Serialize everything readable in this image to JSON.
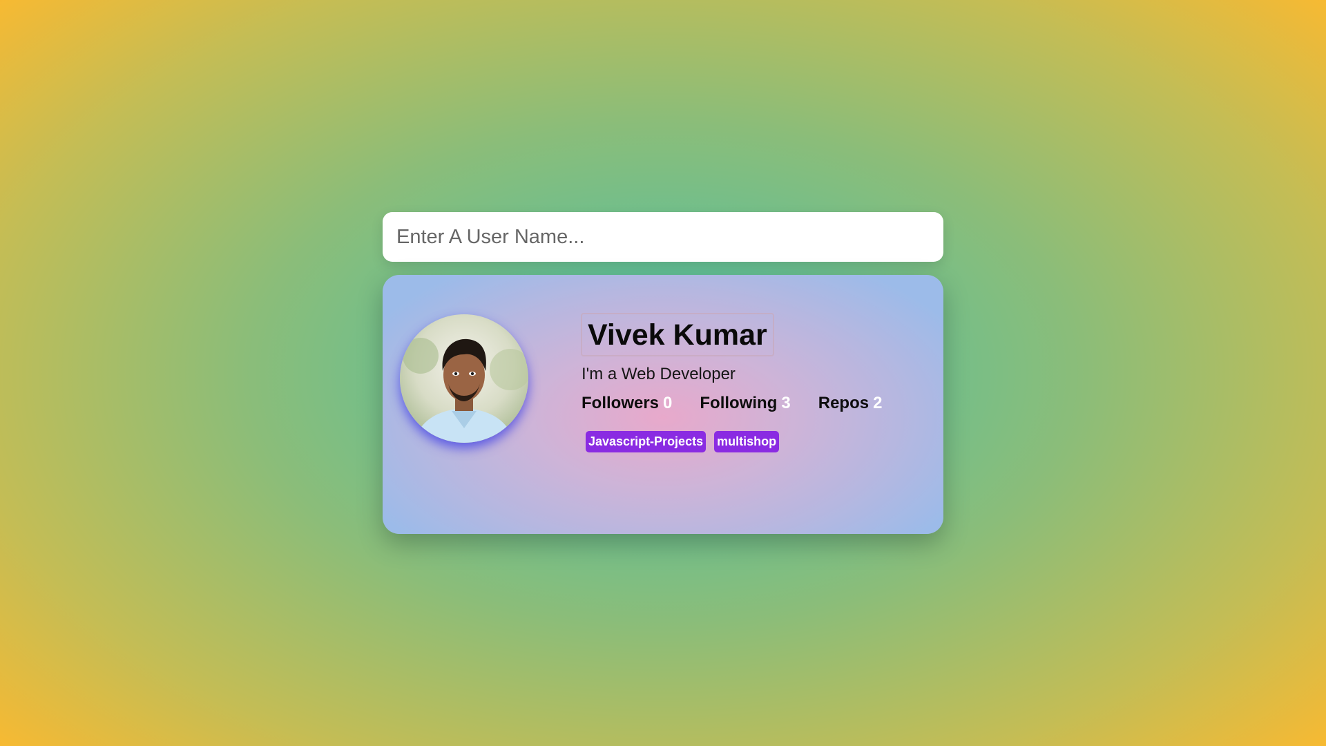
{
  "search": {
    "placeholder": "Enter A User Name...",
    "value": ""
  },
  "profile": {
    "name": "Vivek Kumar",
    "bio": "I'm a Web Developer",
    "stats": [
      {
        "label": "Followers",
        "value": "0"
      },
      {
        "label": "Following",
        "value": "3"
      },
      {
        "label": "Repos",
        "value": "2"
      }
    ],
    "repos": [
      "Javascript-Projects",
      "multishop"
    ]
  },
  "colors": {
    "repo_tag": "#8a2be2",
    "avatar_glow": "#3c3ce6",
    "stat_value": "#ffffff"
  }
}
